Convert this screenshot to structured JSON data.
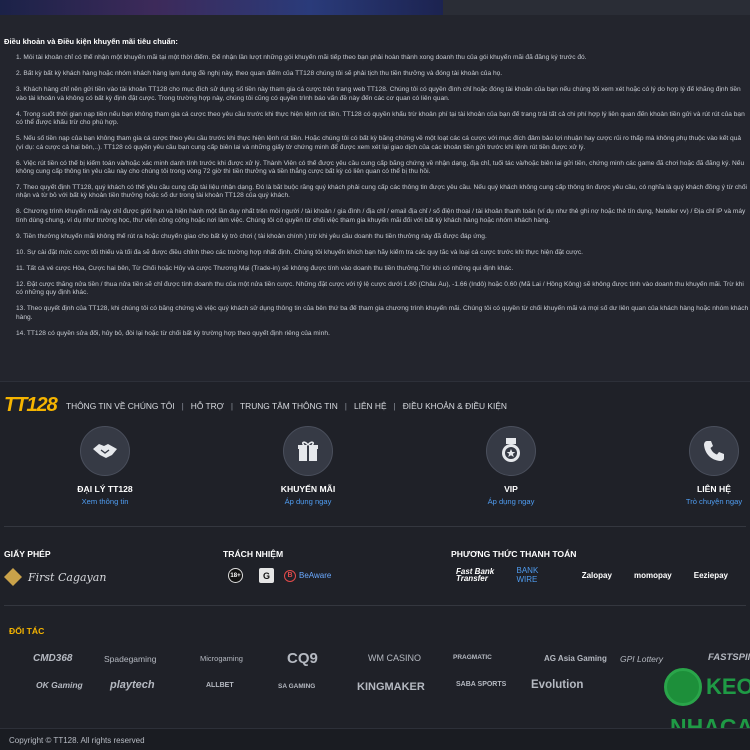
{
  "terms": {
    "title": "Điều khoản và Điều kiện khuyến mãi tiêu chuẩn:",
    "items": [
      "1. Mỗi tài khoản chỉ có thể nhận một khuyến mãi tại một thời điểm. Để nhận lần lượt những gói khuyến mãi tiếp theo bạn phải hoàn thành xong doanh thu của gói khuyến mãi đã đăng ký trước đó.",
      "2. Bất kỳ bất kỳ khách hàng hoặc nhóm khách hàng lạm dụng đề nghị này, theo quan điểm của TT128 chúng tôi sẽ phải tịch thu tiền thưởng và đóng tài khoản của họ.",
      "3. Khách hàng chỉ nên gửi tiền vào tài khoản TT128 cho mục đích sử dụng số tiền này tham gia cá cược trên trang web TT128. Chúng tôi có quyền đình chỉ hoặc đóng tài khoản của bạn nếu chúng tôi xem xét hoặc có lý do hợp lý để khẳng định tiền vào tài khoản và không có bất kỳ định đặt cược. Trong trường hợp này, chúng tôi cũng có quyền trình báo vấn đề này đến các cơ quan có liên quan.",
      "4. Trong suốt thời gian nạp tiền nếu bạn không tham gia cá cược theo yêu cầu trước khi thực hiện lệnh rút tiền. TT128 có quyền khấu trừ khoản phí tại tài khoản của bạn để trang trải tất cả chi phí hợp lý liên quan đến khoản tiền gửi và rút rút của bạn có thể được khấu trừ cho phù hợp.",
      "5. Nếu số tiền nạp của bạn không tham gia cá cược theo yêu cầu trước khi thực hiện lệnh rút tiền. Hoặc chúng tôi có bất kỳ bằng chứng về một loạt các cá cược với mục đích đảm bảo lợi nhuận hay cược rủi ro thấp mà không phụ thuộc vào kết quả (ví dụ: cá cược cả hai bên,..). TT128 có quyền yêu cầu bạn cung cấp biên lai và những giấy tờ chứng minh để được xem xét lại giao dịch của các khoản tiền gửi trước khi lệnh rút tiền được xử lý.",
      "6. Việc rút tiền có thể bị kiểm toán và/hoặc xác minh danh tính trước khi được xử lý. Thành Viên có thể được yêu cầu cung cấp bằng chứng về nhận dạng, địa chỉ, tuổi tác và/hoặc biên lai gửi tiền, chứng minh các game đã chơi hoặc đã đăng ký. Nếu không cung cấp thông tin yêu cầu này cho chúng tôi trong vòng 72 giờ thì tiền thưởng và tiền thắng cược bất kỳ có liên quan có thể bị thu hồi.",
      "7. Theo quyết định TT128, quý khách có thể yêu cầu cung cấp tài liệu nhận dạng. Đó là bắt buộc rằng quý khách phải cung cấp các thông tin được yêu cầu. Nếu quý khách không cung cấp thông tin được yêu cầu, có nghĩa là quý khách đồng ý từ chối nhận và từ bỏ với bất kỳ khoản tiền thưởng hoặc số dư trong tài khoản TT128 của quý khách.",
      "8. Chương trình khuyến mãi này chỉ được giới hạn và hiện hành một lần duy nhất trên mỗi người / tài khoản / gia đình / địa chỉ / email địa chỉ / số điện thoại / tài khoản thanh toán (ví dụ như thẻ ghi nợ hoặc thẻ tín dụng, Neteller vv) / Địa chỉ IP và máy tính dùng chung, ví dụ như trường học, thư viện công cộng hoặc nơi làm việc. Chúng tôi có quyền từ chối việc tham gia khuyến mãi đối với bất kỳ khách hàng hoặc nhóm khách hàng.",
      "9. Tiền thưởng khuyến mãi không thể rút ra hoặc chuyển giao cho bất kỳ trò chơi ( tài khoản chính ) trừ khi yêu cầu doanh thu tiền thưởng này đã được đáp ứng.",
      "10. Sự cài đặt mức cược tối thiểu và tối đa sẽ được điều chỉnh theo các trường hợp nhất định. Chúng tôi khuyến khích bạn hãy kiểm tra các quy tắc và loại cá cược trước khi thực hiện đặt cược.",
      "11. Tất cả vé cược Hòa, Cược hai bên, Từ Chối hoặc Hủy và cược Thương Mại (Trade-in) sẽ không được tính vào doanh thu tiền thưởng.Trừ khi có những qui định khác.",
      "12. Đặt cược thắng nửa tiền / thua nửa tiền sẽ chỉ được tính doanh thu của một nửa tiền cược. Những đặt cược với tỷ lệ cược dưới 1.60 (Châu Âu), -1.66 (Indô) hoặc 0.60 (Mã Lai / Hồng Kông) sẽ không được tính vào doanh thu khuyến mãi. Trừ khi có những quy định khác.",
      "13. Theo quyết định của TT128, khi chúng tôi có bằng chứng về việc quý khách sử dụng thông tin của bên thứ ba để tham gia chương trình khuyến mãi. Chúng tôi có quyền từ chối khuyến mãi và mọi số dư liên quan của khách hàng hoặc nhóm khách hàng.",
      "14. TT128 có quyền sửa đổi, hủy bỏ, đòi lại hoặc từ chối bất kỳ trường hợp theo quyết định riêng của mình."
    ]
  },
  "footer": {
    "logo": "TT128",
    "nav": [
      "THÔNG TIN VỀ CHÚNG TÔI",
      "HỖ TRỢ",
      "TRUNG TÂM THÔNG TIN",
      "LIÊN HỆ",
      "ĐIỀU KHOẢN & ĐIỀU KIỆN"
    ],
    "nav_sep": "|",
    "features": [
      {
        "title": "ĐẠI LÝ TT128",
        "sub": "Xem thông tin",
        "icon": "handshake-icon"
      },
      {
        "title": "KHUYẾN MÃI",
        "sub": "Áp dụng ngay",
        "icon": "gift-icon"
      },
      {
        "title": "VIP",
        "sub": "Áp dụng ngay",
        "icon": "medal-icon"
      },
      {
        "title": "LIÊN HỆ",
        "sub": "Trò chuyện ngay",
        "icon": "phone-icon"
      }
    ],
    "license": {
      "heading": "GIẤY PHÉP",
      "name": "First Cagayan"
    },
    "responsibility": {
      "heading": "TRÁCH NHIỆM",
      "age": "18+",
      "g": "G",
      "gamble_name": "BeAware"
    },
    "payment": {
      "heading": "PHƯƠNG THỨC THANH TOÁN",
      "methods": [
        "Fast Bank Transfer",
        "BANK WIRE",
        "Zalopay",
        "momopay",
        "Eeziepay"
      ]
    },
    "partners_heading": "ĐỐI TÁC",
    "partners_row1": [
      "CMD368",
      "Spadegaming",
      "Microgaming",
      "CQ9",
      "WM CASINO",
      "PRAGMATIC",
      "AG Asia Gaming",
      "GPI Lottery",
      "FASTSPIN"
    ],
    "partners_row2": [
      "OK Gaming",
      "playtech",
      "ALLBET",
      "SA GAMING",
      "KINGMAKER",
      "SABA SPORTS",
      "Evolution"
    ],
    "copyright": "Copyright © TT128. All rights reserved"
  },
  "watermark": {
    "line1": "KEO",
    "line2": "NHACAI"
  },
  "colors": {
    "accent": "#4f9cf0",
    "logo_yellow": "#f5b400",
    "bg": "#23252d",
    "footer_bg": "#1f2128"
  }
}
